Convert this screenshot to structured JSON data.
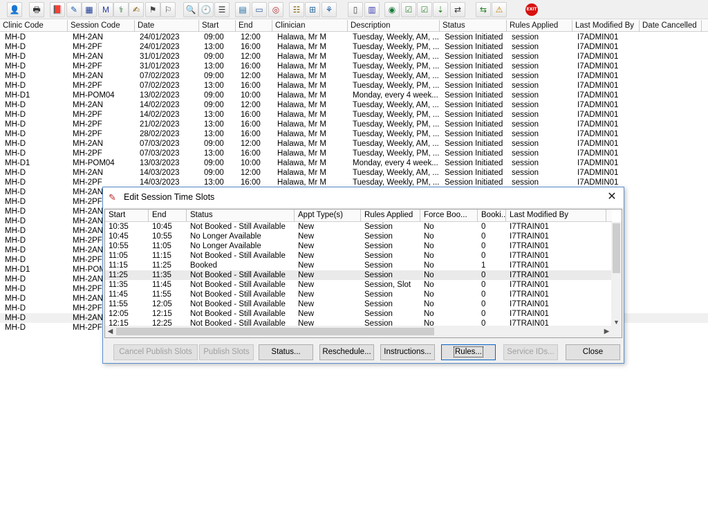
{
  "toolbar": {
    "icons": [
      "user-icon",
      "printer-icon",
      "book-icon",
      "edit-icon",
      "table-icon",
      "mail-icon",
      "doctor-icon",
      "notes-icon",
      "flag-icon",
      "flag2-icon",
      "search-doc-icon",
      "clock-icon",
      "list-icon",
      "chart-icon",
      "card-icon",
      "dial-icon",
      "memo-icon",
      "bed-icon",
      "nurse-icon",
      "page-icon",
      "bar-chart-icon",
      "globe-icon",
      "checklist-icon",
      "checklist2-icon",
      "arrow-down-icon",
      "arrow-swap-icon",
      "transfer-icon",
      "warning-icon",
      "exit-icon"
    ],
    "exit_label": "EXIT"
  },
  "main_grid": {
    "columns": [
      "Clinic Code",
      "Session Code",
      "Date",
      "Start",
      "End",
      "Clinician",
      "Description",
      "Status",
      "Rules Applied",
      "Last Modified By",
      "Date Cancelled"
    ],
    "rows": [
      [
        "MH-D",
        "MH-2AN",
        "24/01/2023",
        "09:00",
        "12:00",
        "Halawa, Mr M",
        "Tuesday, Weekly, AM, ...",
        "Session Initiated",
        "session",
        "I7ADMIN01",
        ""
      ],
      [
        "MH-D",
        "MH-2PF",
        "24/01/2023",
        "13:00",
        "16:00",
        "Halawa, Mr M",
        "Tuesday, Weekly, PM, ...",
        "Session Initiated",
        "session",
        "I7ADMIN01",
        ""
      ],
      [
        "MH-D",
        "MH-2AN",
        "31/01/2023",
        "09:00",
        "12:00",
        "Halawa, Mr M",
        "Tuesday, Weekly, AM, ...",
        "Session Initiated",
        "session",
        "I7ADMIN01",
        ""
      ],
      [
        "MH-D",
        "MH-2PF",
        "31/01/2023",
        "13:00",
        "16:00",
        "Halawa, Mr M",
        "Tuesday, Weekly, PM, ...",
        "Session Initiated",
        "session",
        "I7ADMIN01",
        ""
      ],
      [
        "MH-D",
        "MH-2AN",
        "07/02/2023",
        "09:00",
        "12:00",
        "Halawa, Mr M",
        "Tuesday, Weekly, AM, ...",
        "Session Initiated",
        "session",
        "I7ADMIN01",
        ""
      ],
      [
        "MH-D",
        "MH-2PF",
        "07/02/2023",
        "13:00",
        "16:00",
        "Halawa, Mr M",
        "Tuesday, Weekly, PM, ...",
        "Session Initiated",
        "session",
        "I7ADMIN01",
        ""
      ],
      [
        "MH-D1",
        "MH-POM04",
        "13/02/2023",
        "09:00",
        "10:00",
        "Halawa, Mr M",
        "Monday, every 4 week...",
        "Session Initiated",
        "session",
        "I7ADMIN01",
        ""
      ],
      [
        "MH-D",
        "MH-2AN",
        "14/02/2023",
        "09:00",
        "12:00",
        "Halawa, Mr M",
        "Tuesday, Weekly, AM, ...",
        "Session Initiated",
        "session",
        "I7ADMIN01",
        ""
      ],
      [
        "MH-D",
        "MH-2PF",
        "14/02/2023",
        "13:00",
        "16:00",
        "Halawa, Mr M",
        "Tuesday, Weekly, PM, ...",
        "Session Initiated",
        "session",
        "I7ADMIN01",
        ""
      ],
      [
        "MH-D",
        "MH-2PF",
        "21/02/2023",
        "13:00",
        "16:00",
        "Halawa, Mr M",
        "Tuesday, Weekly, PM, ...",
        "Session Initiated",
        "session",
        "I7ADMIN01",
        ""
      ],
      [
        "MH-D",
        "MH-2PF",
        "28/02/2023",
        "13:00",
        "16:00",
        "Halawa, Mr M",
        "Tuesday, Weekly, PM, ...",
        "Session Initiated",
        "session",
        "I7ADMIN01",
        ""
      ],
      [
        "MH-D",
        "MH-2AN",
        "07/03/2023",
        "09:00",
        "12:00",
        "Halawa, Mr M",
        "Tuesday, Weekly, AM, ...",
        "Session Initiated",
        "session",
        "I7ADMIN01",
        ""
      ],
      [
        "MH-D",
        "MH-2PF",
        "07/03/2023",
        "13:00",
        "16:00",
        "Halawa, Mr M",
        "Tuesday, Weekly, PM, ...",
        "Session Initiated",
        "session",
        "I7ADMIN01",
        ""
      ],
      [
        "MH-D1",
        "MH-POM04",
        "13/03/2023",
        "09:00",
        "10:00",
        "Halawa, Mr M",
        "Monday, every 4 week...",
        "Session Initiated",
        "session",
        "I7ADMIN01",
        ""
      ],
      [
        "MH-D",
        "MH-2AN",
        "14/03/2023",
        "09:00",
        "12:00",
        "Halawa, Mr M",
        "Tuesday, Weekly, AM, ...",
        "Session Initiated",
        "session",
        "I7ADMIN01",
        ""
      ],
      [
        "MH-D",
        "MH-2PF",
        "14/03/2023",
        "13:00",
        "16:00",
        "Halawa, Mr M",
        "Tuesday, Weekly, PM, ...",
        "Session Initiated",
        "session",
        "I7ADMIN01",
        ""
      ],
      [
        "MH-D",
        "MH-2AN",
        "",
        "",
        "",
        "",
        "",
        "",
        "",
        "",
        ""
      ],
      [
        "MH-D",
        "MH-2PF",
        "",
        "",
        "",
        "",
        "",
        "",
        "",
        "",
        ""
      ],
      [
        "MH-D",
        "MH-2AN",
        "",
        "",
        "",
        "",
        "",
        "",
        "",
        "",
        ""
      ],
      [
        "MH-D",
        "MH-2AN",
        "",
        "",
        "",
        "",
        "",
        "",
        "",
        "",
        ""
      ],
      [
        "MH-D",
        "MH-2AN",
        "",
        "",
        "",
        "",
        "",
        "",
        "",
        "",
        ""
      ],
      [
        "MH-D",
        "MH-2PF",
        "",
        "",
        "",
        "",
        "",
        "",
        "",
        "",
        ""
      ],
      [
        "MH-D",
        "MH-2AN",
        "",
        "",
        "",
        "",
        "",
        "",
        "",
        "",
        ""
      ],
      [
        "MH-D",
        "MH-2PF",
        "",
        "",
        "",
        "",
        "",
        "",
        "",
        "",
        ""
      ],
      [
        "MH-D1",
        "MH-POM",
        "",
        "",
        "",
        "",
        "",
        "",
        "",
        "",
        ""
      ],
      [
        "MH-D",
        "MH-2AN",
        "",
        "",
        "",
        "",
        "",
        "",
        "",
        "",
        ""
      ],
      [
        "MH-D",
        "MH-2PF",
        "",
        "",
        "",
        "",
        "",
        "",
        "",
        "",
        ""
      ],
      [
        "MH-D",
        "MH-2AN",
        "",
        "",
        "",
        "",
        "",
        "",
        "",
        "",
        ""
      ],
      [
        "MH-D",
        "MH-2PF",
        "",
        "",
        "",
        "",
        "",
        "",
        "",
        "",
        ""
      ],
      [
        "MH-D",
        "MH-2AN",
        "",
        "",
        "",
        "",
        "",
        "",
        "",
        "",
        ""
      ],
      [
        "MH-D",
        "MH-2PF",
        "",
        "",
        "",
        "",
        "",
        "",
        "",
        "",
        ""
      ]
    ],
    "selected_row": 29
  },
  "dialog": {
    "title": "Edit Session Time Slots",
    "close_glyph": "✕",
    "columns": [
      "Start",
      "End",
      "Status",
      "Appt Type(s)",
      "Rules Applied",
      "Force Boo...",
      "Booki...",
      "Last Modified By"
    ],
    "rows": [
      [
        "10:35",
        "10:45",
        "Not Booked - Still Available",
        "New",
        "Session",
        "No",
        "0",
        "I7TRAIN01"
      ],
      [
        "10:45",
        "10:55",
        "No Longer Available",
        "New",
        "Session",
        "No",
        "0",
        "I7TRAIN01"
      ],
      [
        "10:55",
        "11:05",
        "No Longer Available",
        "New",
        "Session",
        "No",
        "0",
        "I7TRAIN01"
      ],
      [
        "11:05",
        "11:15",
        "Not Booked - Still Available",
        "New",
        "Session",
        "No",
        "0",
        "I7TRAIN01"
      ],
      [
        "11:15",
        "11:25",
        "Booked",
        "New",
        "Session",
        "No",
        "1",
        "I7TRAIN01"
      ],
      [
        "11:25",
        "11:35",
        "Not Booked - Still Available",
        "New",
        "Session",
        "No",
        "0",
        "I7TRAIN01"
      ],
      [
        "11:35",
        "11:45",
        "Not Booked - Still Available",
        "New",
        "Session, Slot",
        "No",
        "0",
        "I7TRAIN01"
      ],
      [
        "11:45",
        "11:55",
        "Not Booked - Still Available",
        "New",
        "Session",
        "No",
        "0",
        "I7TRAIN01"
      ],
      [
        "11:55",
        "12:05",
        "Not Booked - Still Available",
        "New",
        "Session",
        "No",
        "0",
        "I7TRAIN01"
      ],
      [
        "12:05",
        "12:15",
        "Not Booked - Still Available",
        "New",
        "Session",
        "No",
        "0",
        "I7TRAIN01"
      ],
      [
        "12:15",
        "12:25",
        "Not Booked - Still Available",
        "New",
        "Session",
        "No",
        "0",
        "I7TRAIN01"
      ]
    ],
    "selected_row": 5,
    "buttons": {
      "cancel_publish": "Cancel Publish Slots",
      "publish": "Publish Slots",
      "status": "Status...",
      "reschedule": "Reschedule...",
      "instructions": "Instructions...",
      "rules": "Rules...",
      "service_ids": "Service IDs...",
      "close": "Close"
    }
  }
}
